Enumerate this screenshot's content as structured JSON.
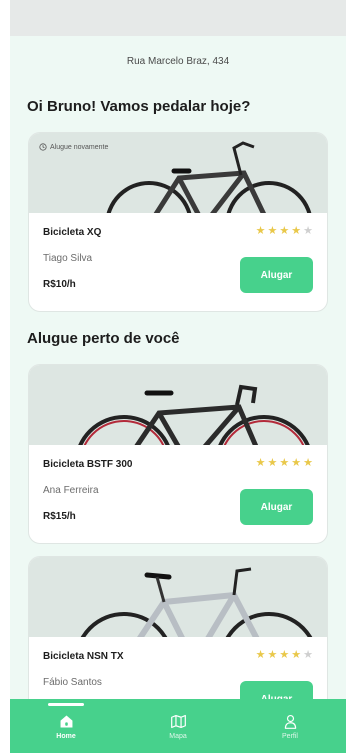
{
  "header": {
    "address": "Rua Marcelo Braz, 434",
    "greeting": "Oi Bruno! Vamos pedalar hoje?"
  },
  "recent": {
    "badge": "Alugue novamente",
    "bike": {
      "name": "Bicicleta XQ",
      "owner": "Tiago Silva",
      "price": "R$10/h",
      "rating": 4,
      "max_rating": 5,
      "button": "Alugar"
    }
  },
  "nearby": {
    "title": "Alugue perto de você",
    "bikes": [
      {
        "name": "Bicicleta BSTF 300",
        "owner": "Ana Ferreira",
        "price": "R$15/h",
        "rating": 5,
        "max_rating": 5,
        "button": "Alugar"
      },
      {
        "name": "Bicicleta NSN TX",
        "owner": "Fábio Santos",
        "price": "",
        "rating": 4,
        "max_rating": 5,
        "button": "Alugar"
      }
    ]
  },
  "tabbar": {
    "tabs": [
      {
        "label": "Home",
        "icon": "home-icon",
        "active": true
      },
      {
        "label": "Mapa",
        "icon": "map-icon",
        "active": false
      },
      {
        "label": "Perfil",
        "icon": "profile-icon",
        "active": false
      }
    ]
  },
  "colors": {
    "accent": "#47d18c",
    "background": "#eef9f4",
    "star": "#e9c84a",
    "star_empty": "#cfcfcf"
  }
}
